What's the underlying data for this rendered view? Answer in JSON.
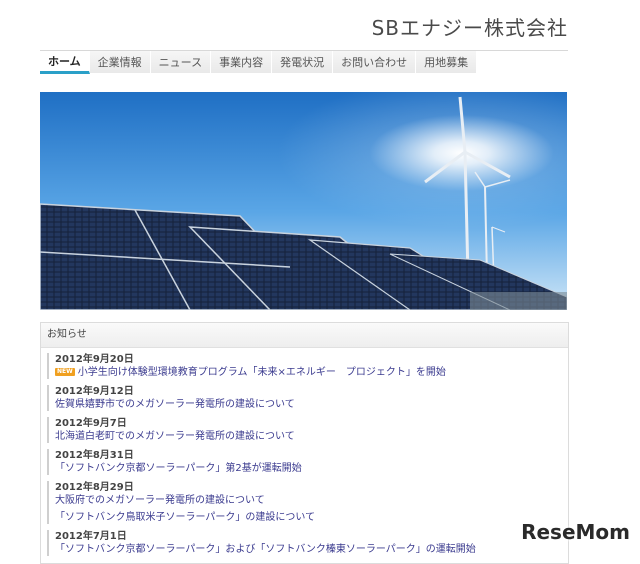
{
  "header": {
    "company_name": "SBエナジー株式会社"
  },
  "nav": {
    "items": [
      {
        "label": "ホーム",
        "active": true
      },
      {
        "label": "企業情報"
      },
      {
        "label": "ニュース"
      },
      {
        "label": "事業内容"
      },
      {
        "label": "発電状況"
      },
      {
        "label": "お問い合わせ"
      },
      {
        "label": "用地募集"
      }
    ]
  },
  "hero": {
    "icon": "solar-panels-wind-turbines-image"
  },
  "notice": {
    "heading": "お知らせ",
    "new_badge": "NEW",
    "items": [
      {
        "date": "2012年9月20日",
        "titles": [
          "小学生向け体験型環境教育プログラム「未来×エネルギー　プロジェクト」を開始"
        ],
        "new": true
      },
      {
        "date": "2012年9月12日",
        "titles": [
          "佐賀県嬉野市でのメガソーラー発電所の建設について"
        ]
      },
      {
        "date": "2012年9月7日",
        "titles": [
          "北海道白老町でのメガソーラー発電所の建設について"
        ]
      },
      {
        "date": "2012年8月31日",
        "titles": [
          "「ソフトバンク京都ソーラーパーク」第2基が運転開始"
        ]
      },
      {
        "date": "2012年8月29日",
        "titles": [
          "大阪府でのメガソーラー発電所の建設について",
          "「ソフトバンク鳥取米子ソーラーパーク」の建設について"
        ]
      },
      {
        "date": "2012年7月1日",
        "titles": [
          "「ソフトバンク京都ソーラーパーク」および「ソフトバンク榛東ソーラーパーク」の運転開始"
        ]
      }
    ]
  },
  "watermark": {
    "text": "ReseMom"
  }
}
